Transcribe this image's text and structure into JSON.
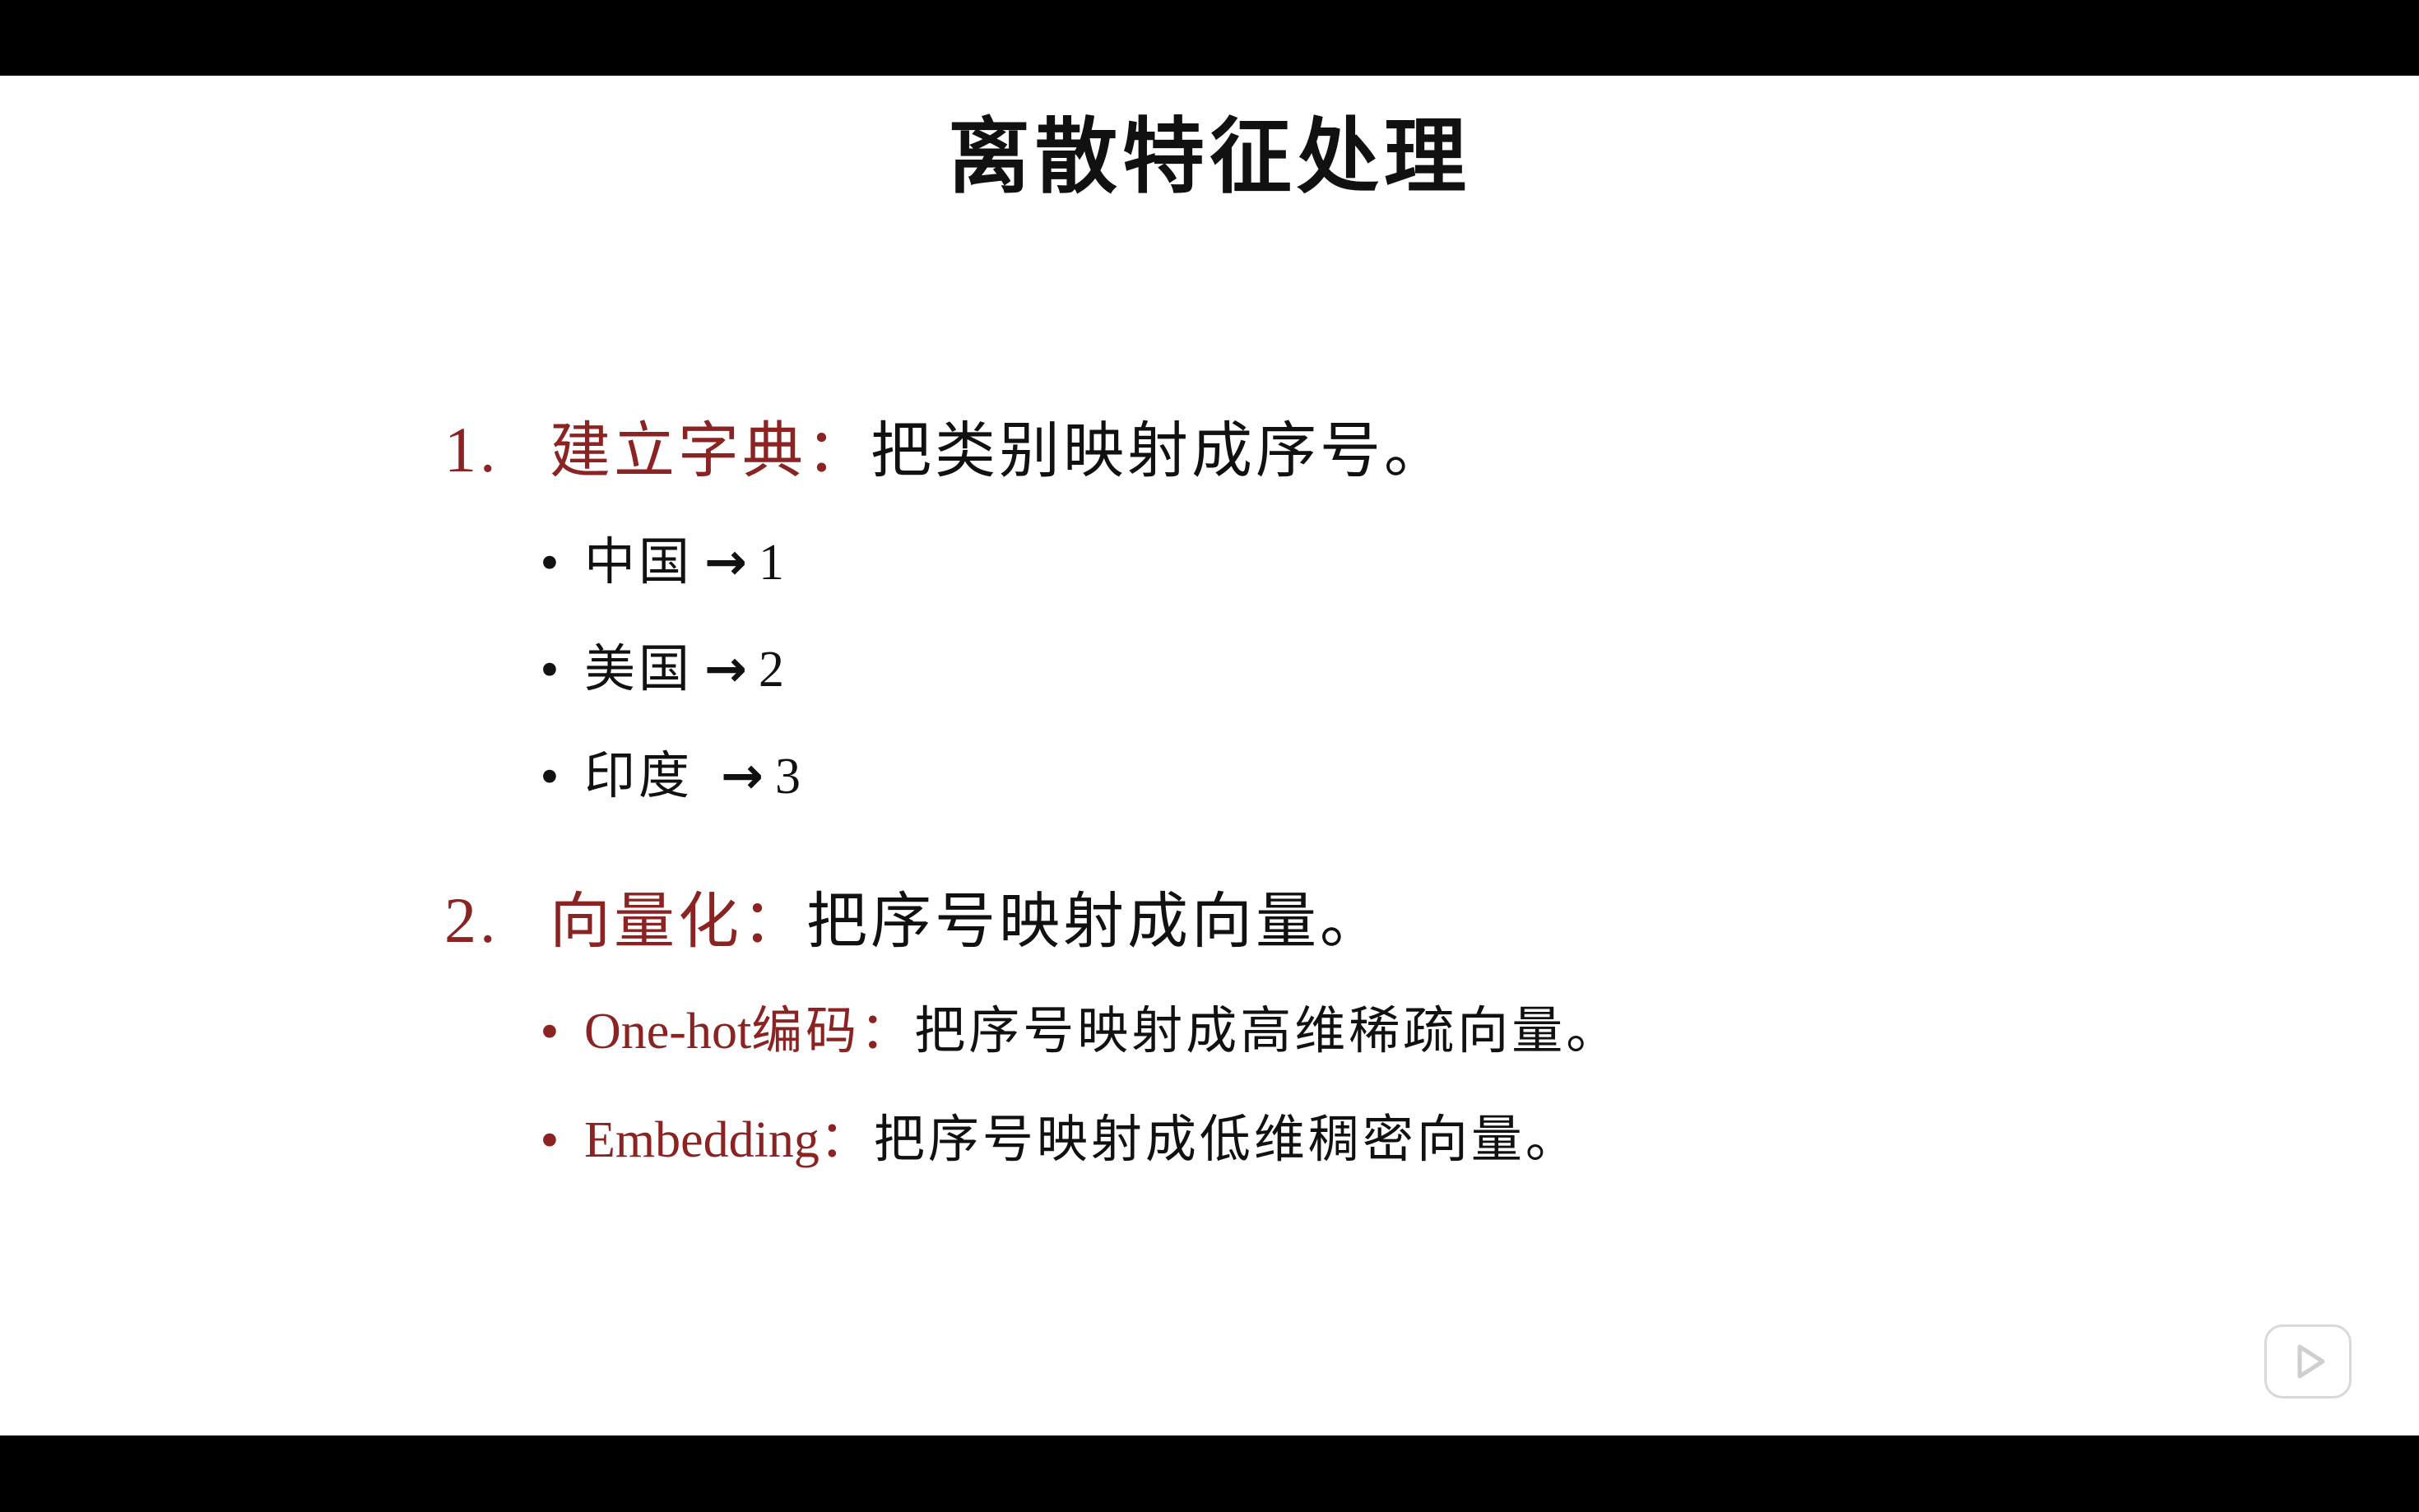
{
  "slide": {
    "title": "离散特征处理",
    "sections": [
      {
        "number": "1.",
        "term": "建立字典",
        "colon": "：",
        "description": "把类别映射成序号。",
        "bullets": [
          {
            "bullet": "•",
            "label": "中国",
            "arrow": "→",
            "value": "1"
          },
          {
            "bullet": "•",
            "label": "美国",
            "arrow": "→",
            "value": "2"
          },
          {
            "bullet": "•",
            "label": "印度",
            "arrow": "→",
            "value": "3"
          }
        ]
      },
      {
        "number": "2.",
        "term": "向量化",
        "colon": "：",
        "description": "把序号映射成向量。",
        "bullets": [
          {
            "bullet": "•",
            "term_latin": "One-hot",
            "term_cjk": "编码",
            "colon": "：",
            "description": "把序号映射成高维稀疏向量。"
          },
          {
            "bullet": "•",
            "term_latin": "Embedding",
            "colon": "：",
            "description": "把序号映射成低维稠密向量。"
          }
        ]
      }
    ]
  },
  "player": {
    "play_icon": "play-icon"
  },
  "colors": {
    "accent": "#8b2323",
    "text": "#111111",
    "background": "#ffffff",
    "letterbox": "#000000"
  }
}
